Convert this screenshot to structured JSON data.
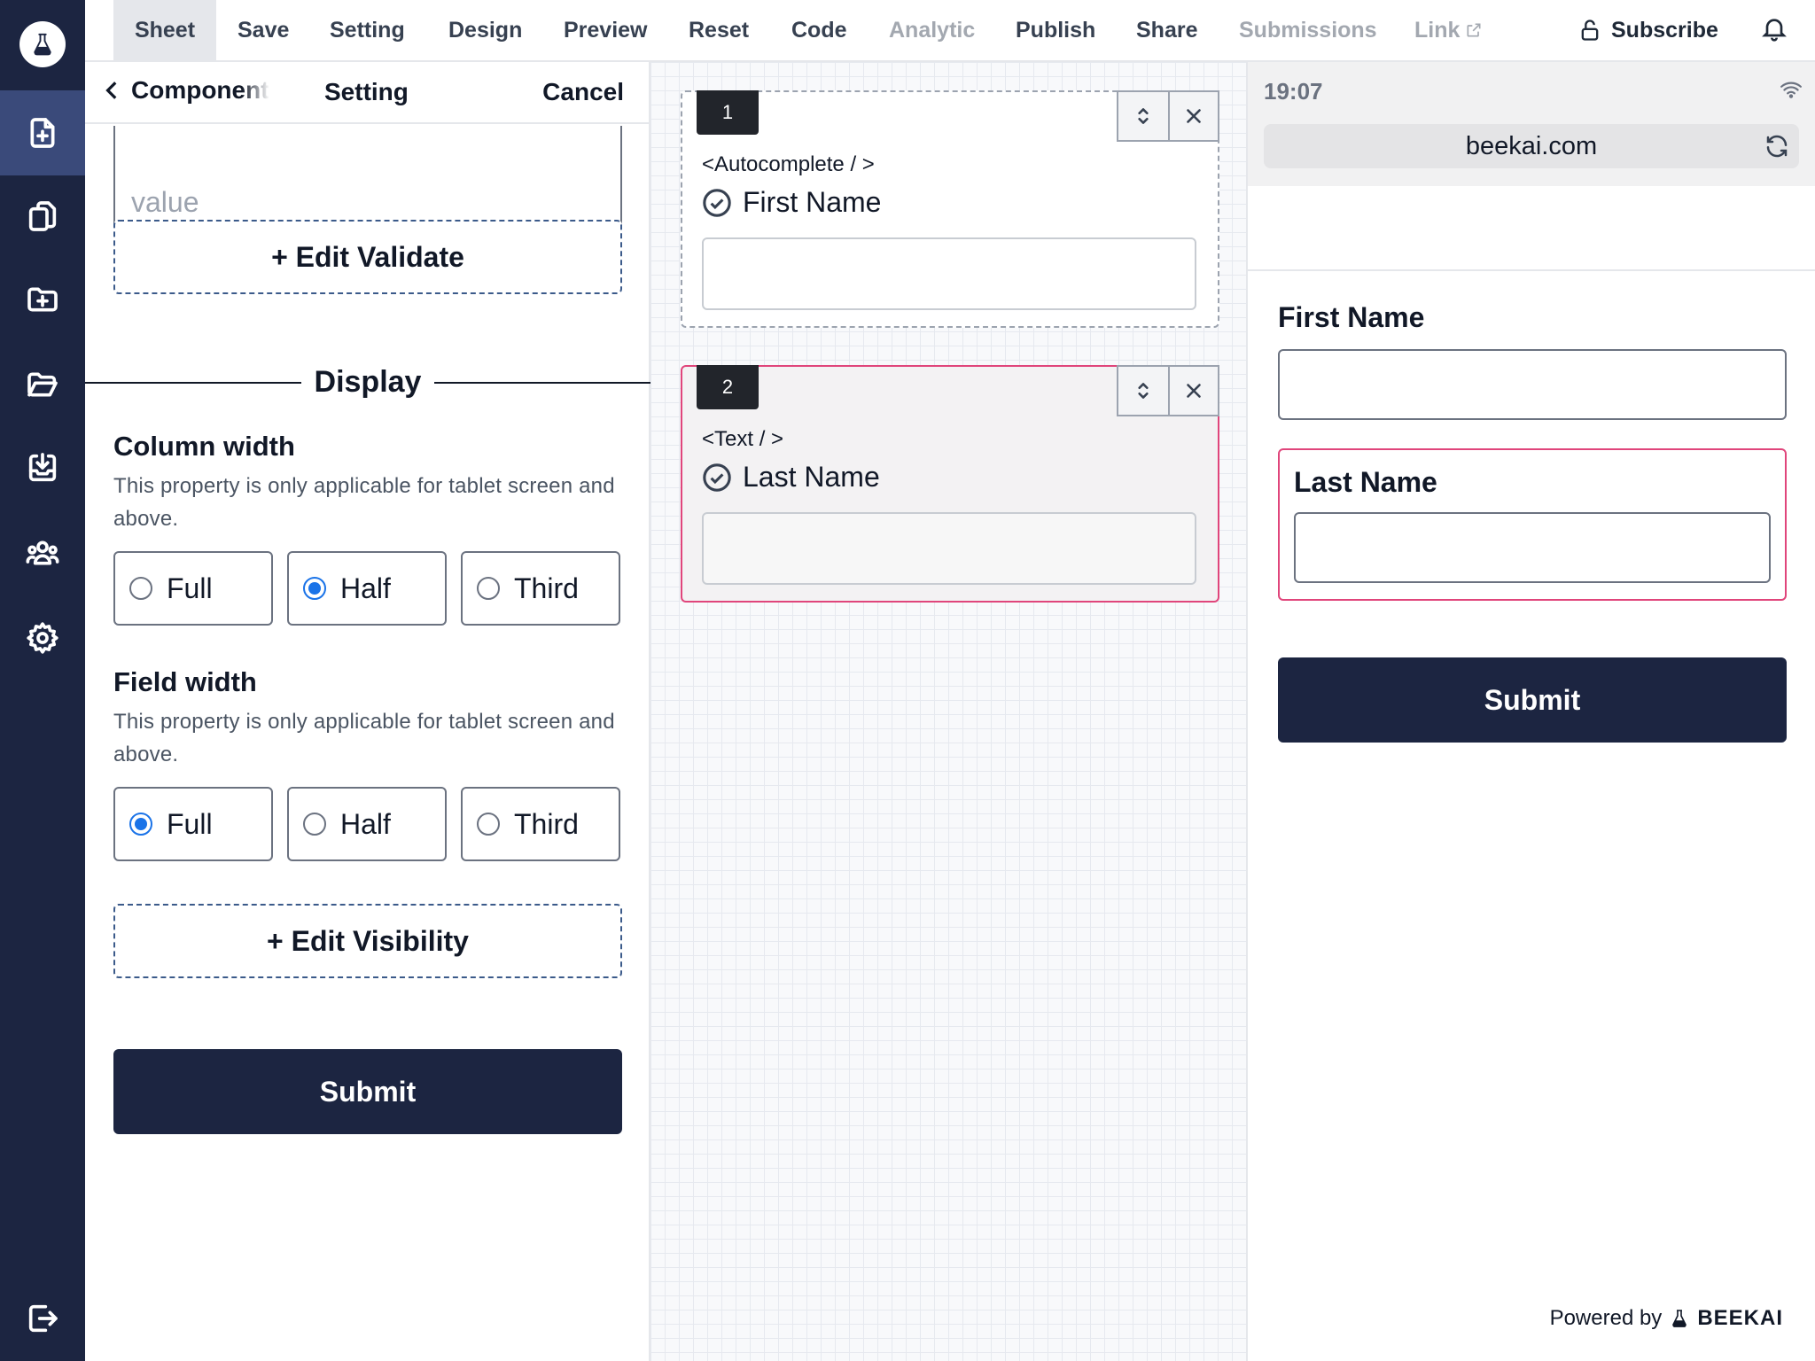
{
  "topbar": {
    "menu": [
      {
        "label": "Sheet",
        "active": true,
        "disabled": false
      },
      {
        "label": "Save",
        "active": false,
        "disabled": false
      },
      {
        "label": "Setting",
        "active": false,
        "disabled": false
      },
      {
        "label": "Design",
        "active": false,
        "disabled": false
      },
      {
        "label": "Preview",
        "active": false,
        "disabled": false
      },
      {
        "label": "Reset",
        "active": false,
        "disabled": false
      },
      {
        "label": "Code",
        "active": false,
        "disabled": false
      },
      {
        "label": "Analytic",
        "active": false,
        "disabled": true
      },
      {
        "label": "Publish",
        "active": false,
        "disabled": false
      },
      {
        "label": "Share",
        "active": false,
        "disabled": false
      },
      {
        "label": "Submissions",
        "active": false,
        "disabled": true
      },
      {
        "label": "Link",
        "active": false,
        "disabled": true
      }
    ],
    "subscribe_label": "Subscribe"
  },
  "sidebar": {
    "icons": [
      "logo-flask-icon",
      "file-plus-icon",
      "files-icon",
      "folder-plus-icon",
      "folder-open-icon",
      "inbox-download-icon",
      "users-icon",
      "gear-icon",
      "logout-icon"
    ],
    "active_index": 1
  },
  "settings": {
    "back_label": "Component",
    "title": "Setting",
    "cancel_label": "Cancel",
    "value_placeholder": "value",
    "edit_validate_label": "+ Edit Validate",
    "display_label": "Display",
    "column_width": {
      "title": "Column width",
      "description": "This property is only applicable for tablet screen and above.",
      "options": [
        "Full",
        "Half",
        "Third"
      ],
      "selected": "Half"
    },
    "field_width": {
      "title": "Field width",
      "description": "This property is only applicable for tablet screen and above.",
      "options": [
        "Full",
        "Half",
        "Third"
      ],
      "selected": "Full"
    },
    "edit_visibility_label": "+ Edit Visibility",
    "submit_label": "Submit"
  },
  "canvas": {
    "components": [
      {
        "index": "1",
        "tag": "<Autocomplete / >",
        "label": "First Name"
      },
      {
        "index": "2",
        "tag": "<Text / >",
        "label": "Last Name"
      }
    ]
  },
  "preview": {
    "time": "19:07",
    "url": "beekai.com",
    "fields": [
      "First Name",
      "Last Name"
    ],
    "submit_label": "Submit",
    "powered_by": "Powered by",
    "brand": "BEEKAI"
  },
  "colors": {
    "navy": "#1c2541",
    "rail_active": "#3a4a7a",
    "selection_pink": "#e0457b",
    "radio_blue": "#1a73e8"
  }
}
